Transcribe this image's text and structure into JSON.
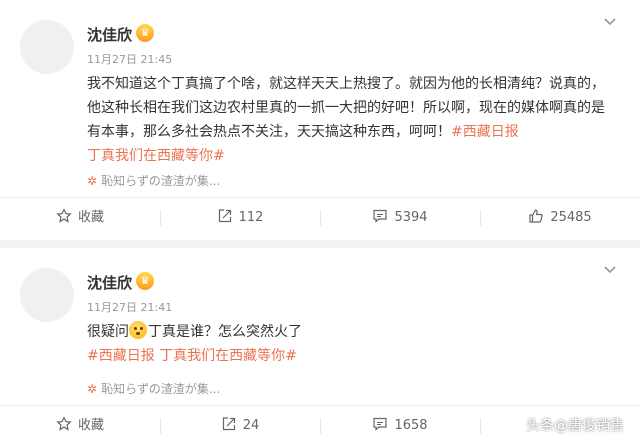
{
  "posts": [
    {
      "user": "沈佳欣",
      "time": "11月27日 21:45",
      "text": "我不知道这个丁真搞了个啥，就这样天天上热搜了。就因为他的长相清纯？说真的，他这种长相在我们这边农村里真的一抓一大把的好吧！所以啊，现在的媒体啊真的是有本事，那么多社会热点不关注，天天搞这种东西，呵呵！",
      "topic1": "#西藏日报",
      "topic2": "丁真我们在西藏等你#",
      "source": "恥知らずの渣渣が集...",
      "actions": {
        "fav": "收藏",
        "share": "112",
        "comment": "5394",
        "like": "25485"
      }
    },
    {
      "user": "沈佳欣",
      "time": "11月27日 21:41",
      "text_pre": "很疑问",
      "text_post": "丁真是谁？怎么突然火了",
      "topic1": "#西藏日报",
      "topic2": "丁真我们在西藏等你#",
      "source": "恥知らずの渣渣が集...",
      "actions": {
        "fav": "收藏",
        "share": "24",
        "comment": "1658"
      }
    }
  ],
  "watermark": "头条@唐俊销售",
  "colors": {
    "topic": "#eb7350",
    "meta": "#999999",
    "separator": "#f2f2f2"
  },
  "icons": [
    "more-icon",
    "vip-badge-icon",
    "star-icon",
    "share-icon",
    "comment-icon",
    "like-icon",
    "emoji-thinking-icon"
  ]
}
